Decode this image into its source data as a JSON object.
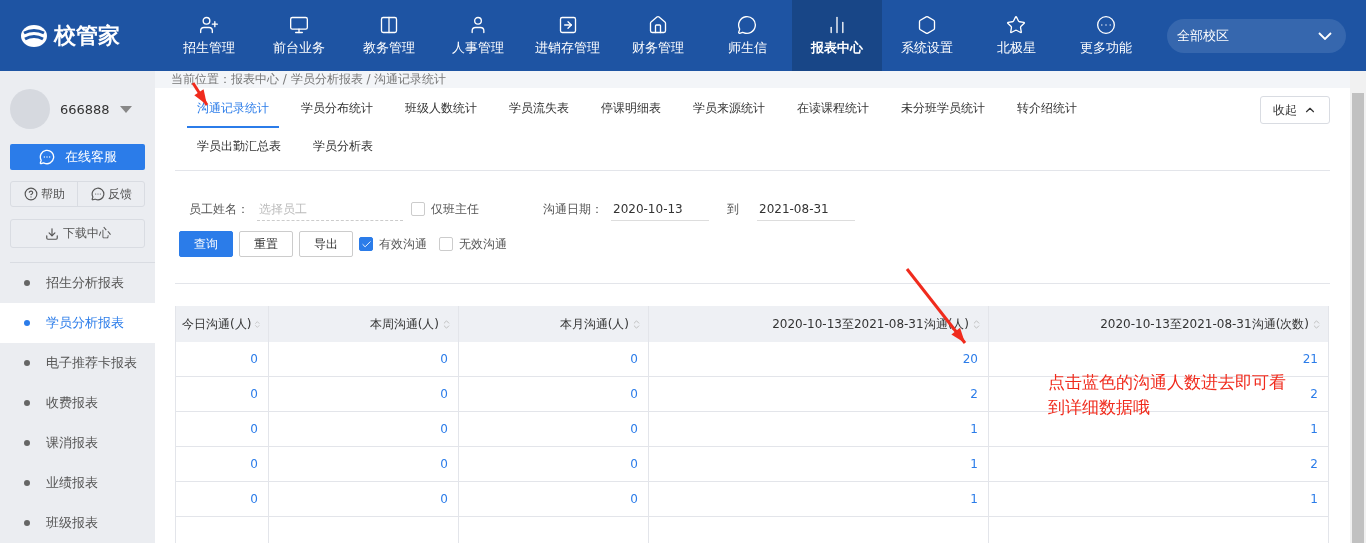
{
  "nav": {
    "logo": "校管家",
    "items": [
      {
        "label": "招生管理",
        "selected": false
      },
      {
        "label": "前台业务",
        "selected": false
      },
      {
        "label": "教务管理",
        "selected": false
      },
      {
        "label": "人事管理",
        "selected": false
      },
      {
        "label": "进销存管理",
        "selected": false
      },
      {
        "label": "财务管理",
        "selected": false
      },
      {
        "label": "师生信",
        "selected": false
      },
      {
        "label": "报表中心",
        "selected": true
      },
      {
        "label": "系统设置",
        "selected": false
      },
      {
        "label": "北极星",
        "selected": false
      },
      {
        "label": "更多功能",
        "selected": false
      }
    ],
    "campus": "全部校区"
  },
  "sidebar": {
    "user": "666888",
    "service": "在线客服",
    "help": "帮助",
    "feedback": "反馈",
    "download": "下载中心",
    "items": [
      {
        "label": "招生分析报表",
        "selected": false
      },
      {
        "label": "学员分析报表",
        "selected": true
      },
      {
        "label": "电子推荐卡报表",
        "selected": false
      },
      {
        "label": "收费报表",
        "selected": false
      },
      {
        "label": "课消报表",
        "selected": false
      },
      {
        "label": "业绩报表",
        "selected": false
      },
      {
        "label": "班级报表",
        "selected": false
      }
    ]
  },
  "breadcrumb": "当前位置：报表中心 / 学员分析报表 / 沟通记录统计",
  "tabs": [
    {
      "label": "沟通记录统计",
      "selected": true
    },
    {
      "label": "学员分布统计",
      "selected": false
    },
    {
      "label": "班级人数统计",
      "selected": false
    },
    {
      "label": "学员流失表",
      "selected": false
    },
    {
      "label": "停课明细表",
      "selected": false
    },
    {
      "label": "学员来源统计",
      "selected": false
    },
    {
      "label": "在读课程统计",
      "selected": false
    },
    {
      "label": "未分班学员统计",
      "selected": false
    },
    {
      "label": "转介绍统计",
      "selected": false
    },
    {
      "label": "学员出勤汇总表",
      "selected": false
    },
    {
      "label": "学员分析表",
      "selected": false
    }
  ],
  "collapse": "收起",
  "filter": {
    "staff_label": "员工姓名：",
    "staff_placeholder": "选择员工",
    "head_teacher": {
      "label": "仅班主任",
      "checked": false
    },
    "date_label": "沟通日期：",
    "date_from": "2020-10-13",
    "date_sep": "到",
    "date_to": "2021-08-31",
    "buttons": [
      {
        "label": "查询",
        "primary": true
      },
      {
        "label": "重置",
        "primary": false
      },
      {
        "label": "导出",
        "primary": false
      }
    ],
    "options": [
      {
        "label": "有效沟通",
        "checked": true
      },
      {
        "label": "无效沟通",
        "checked": false
      }
    ]
  },
  "table": {
    "columns": [
      "今日沟通(人)",
      "本周沟通(人)",
      "本月沟通(人)",
      "2020-10-13至2021-08-31沟通(人)",
      "2020-10-13至2021-08-31沟通(次数)"
    ],
    "rows": [
      [
        "0",
        "0",
        "0",
        "20",
        "21"
      ],
      [
        "0",
        "0",
        "0",
        "2",
        "2"
      ],
      [
        "0",
        "0",
        "0",
        "1",
        "1"
      ],
      [
        "0",
        "0",
        "0",
        "1",
        "2"
      ],
      [
        "0",
        "0",
        "0",
        "1",
        "1"
      ]
    ]
  },
  "annotation": "点击蓝色的沟通人数进去即可看到详细数据哦"
}
